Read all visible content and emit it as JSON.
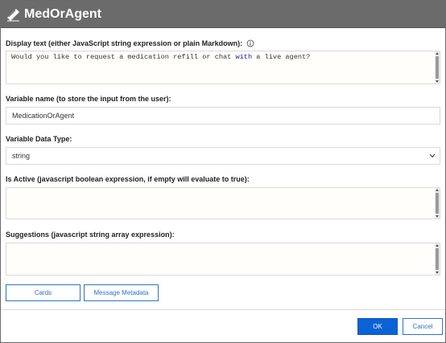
{
  "dialog": {
    "title": "MedOrAgent",
    "icon": "edit-icon"
  },
  "display_text": {
    "label": "Display text (either JavaScript string expression or plain Markdown):",
    "info_icon": "info-icon",
    "value_before": "Would you like to request a medication refill or chat ",
    "value_keyword": "with",
    "value_after": " a live agent?"
  },
  "variable_name": {
    "label": "Variable name (to store the input from the user):",
    "value": "MedicationOrAgent"
  },
  "variable_type": {
    "label": "Variable Data Type:",
    "value": "string"
  },
  "is_active": {
    "label": "Is Active (javascript boolean expression, if empty will evaluate to true):",
    "value": ""
  },
  "suggestions": {
    "label": "Suggestions (javascript string array expression):",
    "value": ""
  },
  "buttons": {
    "cards": "Cards",
    "message_metadata": "Message Metadata",
    "ok": "OK",
    "cancel": "Cancel"
  },
  "colors": {
    "titlebar": "#6b6b6b",
    "primary": "#0a63d6",
    "link": "#2b73c8"
  }
}
